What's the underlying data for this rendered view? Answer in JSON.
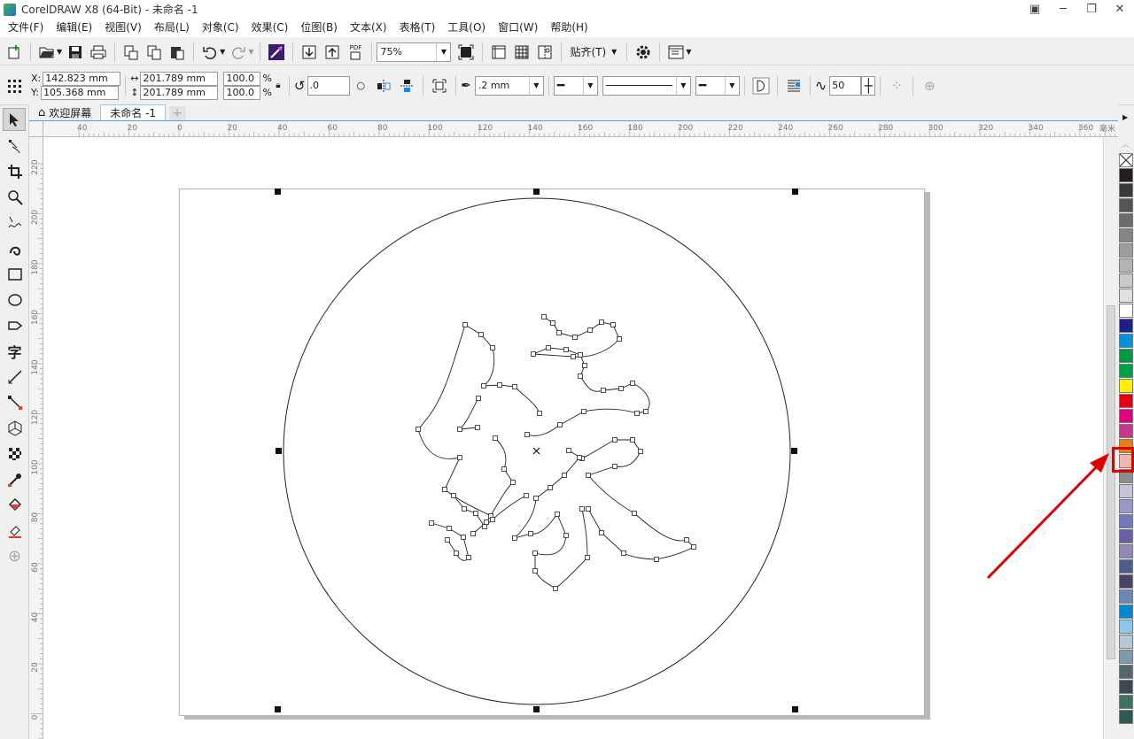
{
  "window": {
    "title": "CorelDRAW X8 (64-Bit) - 未命名 -1",
    "controls": [
      "restore-icon",
      "minimize-icon",
      "maximize-icon",
      "close-icon"
    ]
  },
  "menu": [
    "文件(F)",
    "编辑(E)",
    "视图(V)",
    "布局(L)",
    "对象(C)",
    "效果(C)",
    "位图(B)",
    "文本(X)",
    "表格(T)",
    "工具(O)",
    "窗口(W)",
    "帮助(H)"
  ],
  "toolbar1": {
    "zoom": "75%",
    "snap_label": "贴齐(T)",
    "pdf_label": "PDF"
  },
  "property_bar": {
    "x_label": "X:",
    "x_value": "142.823 mm",
    "y_label": "Y:",
    "y_value": "105.368 mm",
    "width_value": "201.789 mm",
    "height_value": "201.789 mm",
    "scale_x": "100.0",
    "scale_y": "100.0",
    "percent": "%",
    "rotation": ".0",
    "outline_width": ".2 mm",
    "smoothing": "50"
  },
  "tabs": {
    "welcome": "欢迎屏幕",
    "document": "未命名 -1"
  },
  "ruler": {
    "h_labels": [
      "40",
      "20",
      "0",
      "20",
      "40",
      "60",
      "80",
      "100",
      "120",
      "140",
      "160",
      "180",
      "200",
      "220",
      "240",
      "260",
      "280",
      "300",
      "320",
      "340",
      "360"
    ],
    "unit": "毫米",
    "v_labels": [
      "220",
      "200",
      "180",
      "160",
      "140",
      "120",
      "100",
      "80",
      "60",
      "40",
      "20",
      "0"
    ]
  },
  "toolbox": {
    "text_tool_glyph": "字"
  },
  "palette": {
    "colors": [
      "#231f20",
      "#3a3a3a",
      "#555555",
      "#6b6b6b",
      "#858585",
      "#9d9d9d",
      "#b4b4b4",
      "#cacaca",
      "#e0e0e0",
      "#ffffff",
      "#1d2088",
      "#0093dd",
      "#009944",
      "#00a04a",
      "#fff100",
      "#e60012",
      "#e4007f",
      "#c8368a",
      "#e97f10",
      "#f4b5b0",
      "#8d8d8d",
      "#c5c3dc",
      "#9b97c6",
      "#6f79b8",
      "#6a5ea6",
      "#9188b7",
      "#4c5e8c",
      "#4a4466",
      "#6889b6",
      "#0089d0",
      "#8ec7ec",
      "#b3c8d4",
      "#7f9aa8",
      "#53666f",
      "#3e4a52",
      "#407160",
      "#2b5c4f"
    ],
    "highlighted_index": 19
  }
}
